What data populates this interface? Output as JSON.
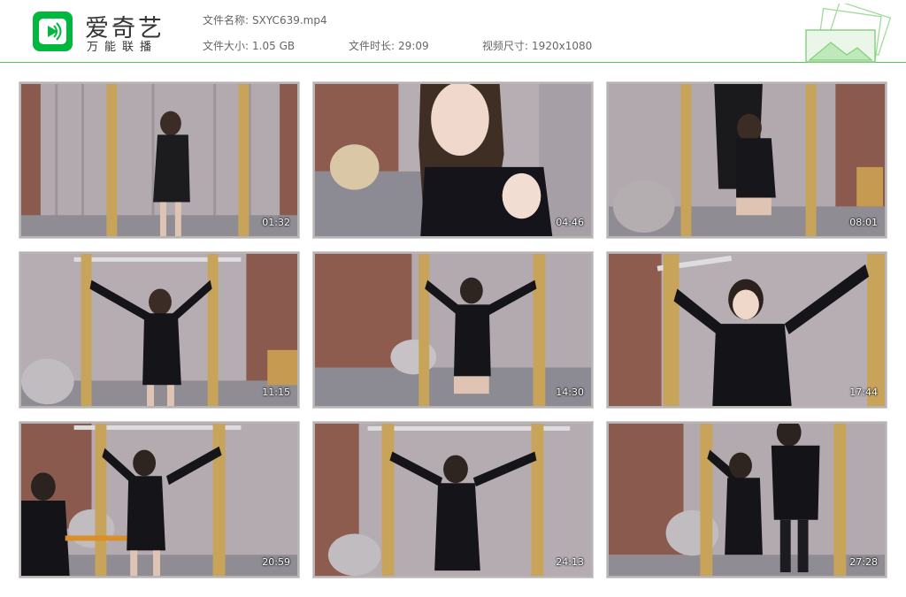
{
  "brand": {
    "name": "爱奇艺",
    "tagline": "万能联播",
    "accent_color": "#00b83e",
    "header_line_color": "#5fbf5a"
  },
  "file_info": {
    "name_label": "文件名称:",
    "name_value": "SXYC639.mp4",
    "size_label": "文件大小:",
    "size_value": "1.05 GB",
    "duration_label": "文件时长:",
    "duration_value": "29:09",
    "resolution_label": "视频尺寸:",
    "resolution_value": "1920x1080"
  },
  "icons": [
    "iqiyi-logo-icon",
    "photo-stack-icon"
  ],
  "thumbnails": [
    {
      "timestamp": "01:32",
      "scene": "wide-curtain-brick"
    },
    {
      "timestamp": "04:46",
      "scene": "closeup-face"
    },
    {
      "timestamp": "08:01",
      "scene": "two-people-kneeling"
    },
    {
      "timestamp": "11:15",
      "scene": "arms-spread-wide"
    },
    {
      "timestamp": "14:30",
      "scene": "kneeling-arms-spread"
    },
    {
      "timestamp": "17:44",
      "scene": "closeup-arms-spread"
    },
    {
      "timestamp": "20:59",
      "scene": "arms-spread-seated-man"
    },
    {
      "timestamp": "24:13",
      "scene": "arms-spread-center"
    },
    {
      "timestamp": "27:28",
      "scene": "two-people-standing"
    }
  ]
}
